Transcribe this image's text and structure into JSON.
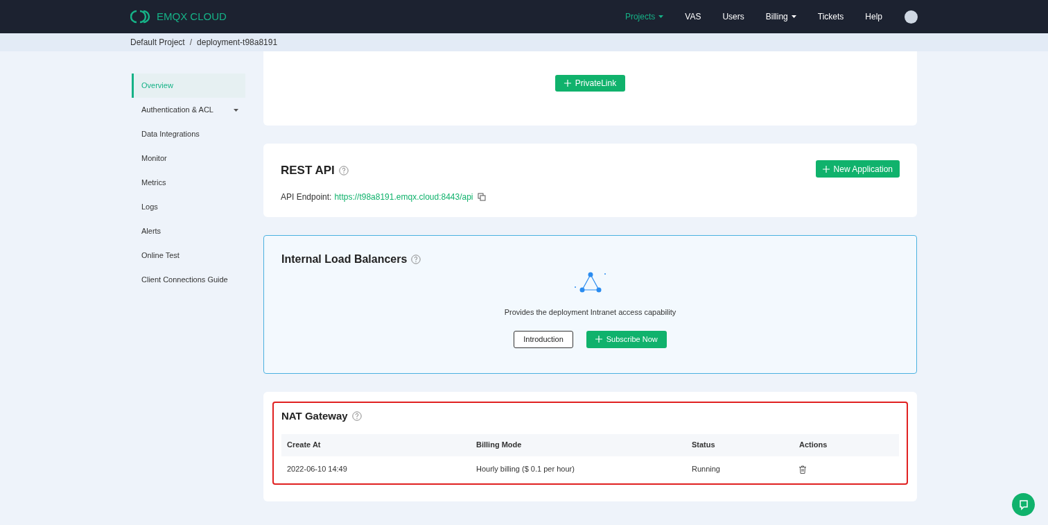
{
  "brand": {
    "name": "EMQX CLOUD"
  },
  "nav": [
    {
      "label": "Projects",
      "selected": true,
      "caret": true
    },
    {
      "label": "VAS",
      "selected": false,
      "caret": false
    },
    {
      "label": "Users",
      "selected": false,
      "caret": false
    },
    {
      "label": "Billing",
      "selected": false,
      "caret": true
    },
    {
      "label": "Tickets",
      "selected": false,
      "caret": false
    },
    {
      "label": "Help",
      "selected": false,
      "caret": false
    }
  ],
  "breadcrumb": [
    "Default Project",
    "deployment-t98a8191"
  ],
  "breadcrumb_separator": "/",
  "sidebar": {
    "items": [
      {
        "label": "Overview",
        "selected": true,
        "caret": false
      },
      {
        "label": "Authentication & ACL",
        "selected": false,
        "caret": true
      },
      {
        "label": "Data Integrations",
        "selected": false,
        "caret": false
      },
      {
        "label": "Monitor",
        "selected": false,
        "caret": false
      },
      {
        "label": "Metrics",
        "selected": false,
        "caret": false
      },
      {
        "label": "Logs",
        "selected": false,
        "caret": false
      },
      {
        "label": "Alerts",
        "selected": false,
        "caret": false
      },
      {
        "label": "Online Test",
        "selected": false,
        "caret": false
      },
      {
        "label": "Client Connections Guide",
        "selected": false,
        "caret": false
      }
    ]
  },
  "privatelink": {
    "button": "PrivateLink"
  },
  "rest_api": {
    "title": "REST API",
    "button": "New Application",
    "endpoint_label": "API Endpoint:",
    "endpoint_url": "https://t98a8191.emqx.cloud:8443/api"
  },
  "load_balancers": {
    "title": "Internal Load Balancers",
    "description": "Provides the deployment Intranet access capability",
    "buttons": [
      {
        "label": "Introduction",
        "kind": "outline"
      },
      {
        "label": "Subscribe Now",
        "kind": "primary"
      }
    ]
  },
  "nat_gateway": {
    "title": "NAT Gateway",
    "highlighted": true,
    "columns": [
      "Create At",
      "Billing Mode",
      "Status",
      "Actions"
    ],
    "rows": [
      {
        "created": "2022-06-10 14:49",
        "billing": "Hourly billing ($ 0.1 per hour)",
        "status": "Running"
      }
    ]
  }
}
